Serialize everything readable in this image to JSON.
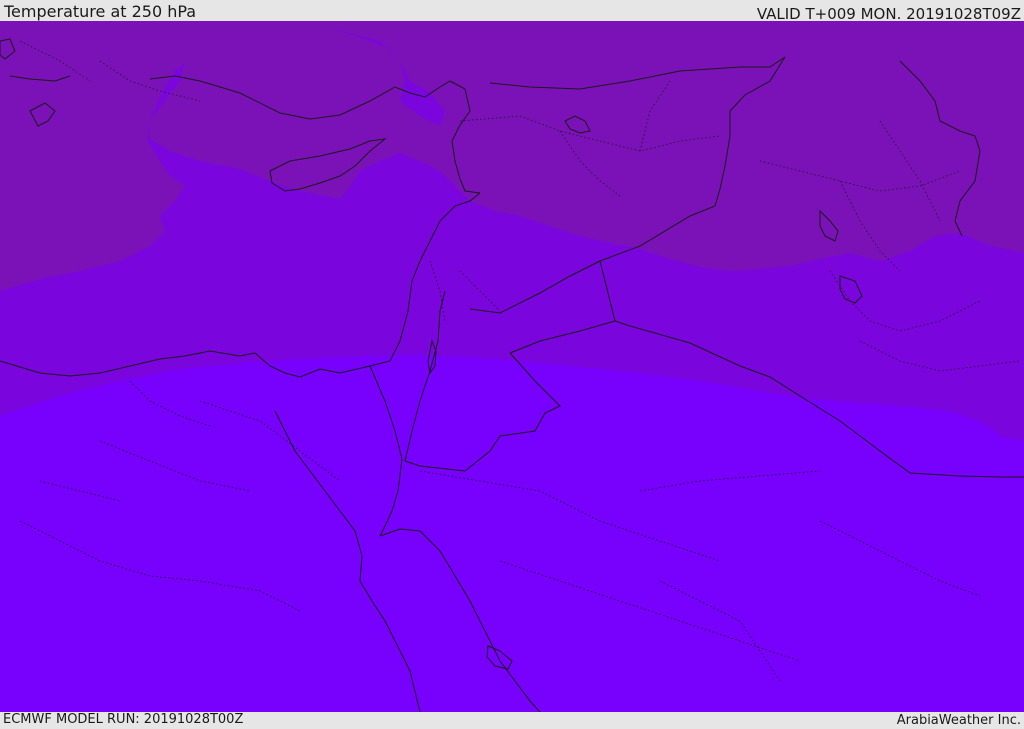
{
  "header": {
    "title": "Temperature at 250 hPa",
    "valid": "VALID T+009 MON. 20191028T09Z"
  },
  "footer": {
    "model_run": "ECMWF MODEL RUN: 20191028T00Z",
    "credit": "ArabiaWeather Inc."
  },
  "map": {
    "field": "temperature-250hPa",
    "colors": {
      "dark_band": "#7a12b8",
      "mid_band": "#7a05dd",
      "light_band": "#7800fd",
      "coastline": "#1a1a1a",
      "border": "#1a1a1a"
    }
  }
}
